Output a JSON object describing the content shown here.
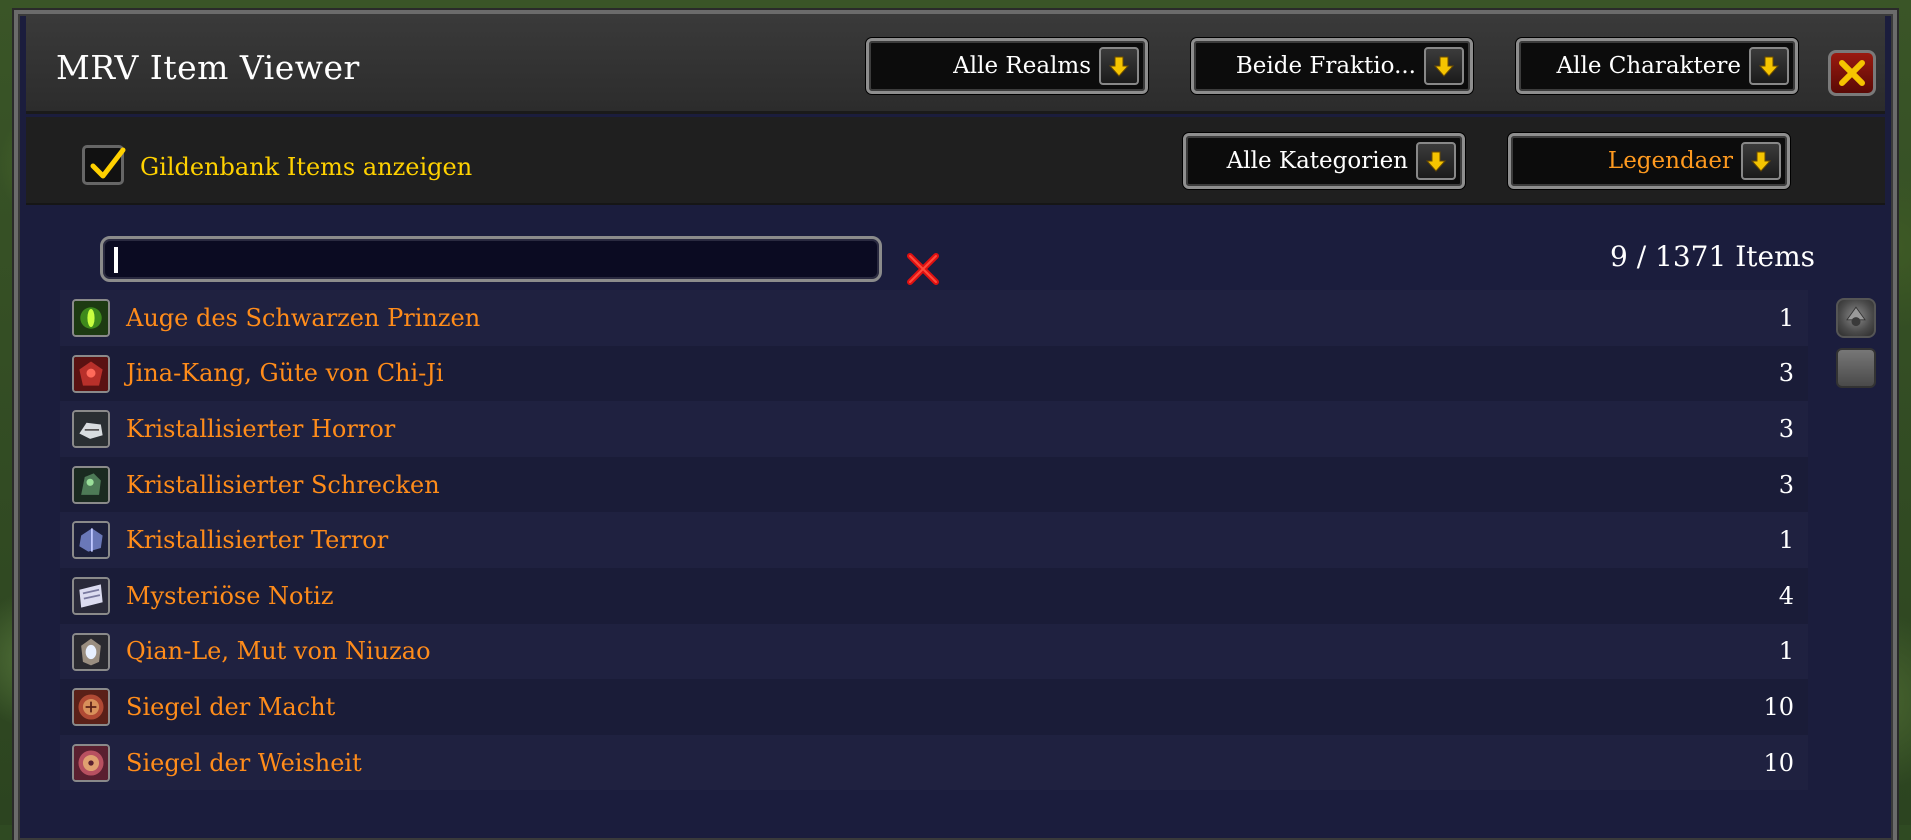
{
  "window": {
    "title": "MRV Item Viewer",
    "close_label": "Close"
  },
  "filters": {
    "realm": "Alle Realms",
    "faction": "Beide Fraktio...",
    "character": "Alle Charaktere",
    "category": "Alle Kategorien",
    "quality": "Legendaer",
    "guildbank_label": "Gildenbank Items anzeigen",
    "guildbank_checked": true
  },
  "search": {
    "value": "",
    "count_text": "9 / 1371 Items"
  },
  "items": [
    {
      "name": "Auge des Schwarzen Prinzen",
      "qty": "1",
      "icon": "eye-gem-icon"
    },
    {
      "name": "Jina-Kang, Güte von Chi-Ji",
      "qty": "3",
      "icon": "red-crest-icon"
    },
    {
      "name": "Kristallisierter Horror",
      "qty": "3",
      "icon": "crystal-horror-icon"
    },
    {
      "name": "Kristallisierter Schrecken",
      "qty": "3",
      "icon": "crystal-dread-icon"
    },
    {
      "name": "Kristallisierter Terror",
      "qty": "1",
      "icon": "crystal-terror-icon"
    },
    {
      "name": "Mysteriöse Notiz",
      "qty": "4",
      "icon": "note-icon"
    },
    {
      "name": "Qian-Le, Mut von Niuzao",
      "qty": "1",
      "icon": "ox-crest-icon"
    },
    {
      "name": "Siegel der Macht",
      "qty": "10",
      "icon": "seal-power-icon"
    },
    {
      "name": "Siegel der Weisheit",
      "qty": "10",
      "icon": "seal-wisdom-icon"
    }
  ],
  "colors": {
    "legendary": "#ff8c1a",
    "gold_text": "#ffd100",
    "list_bg": "#1b1d3d"
  }
}
